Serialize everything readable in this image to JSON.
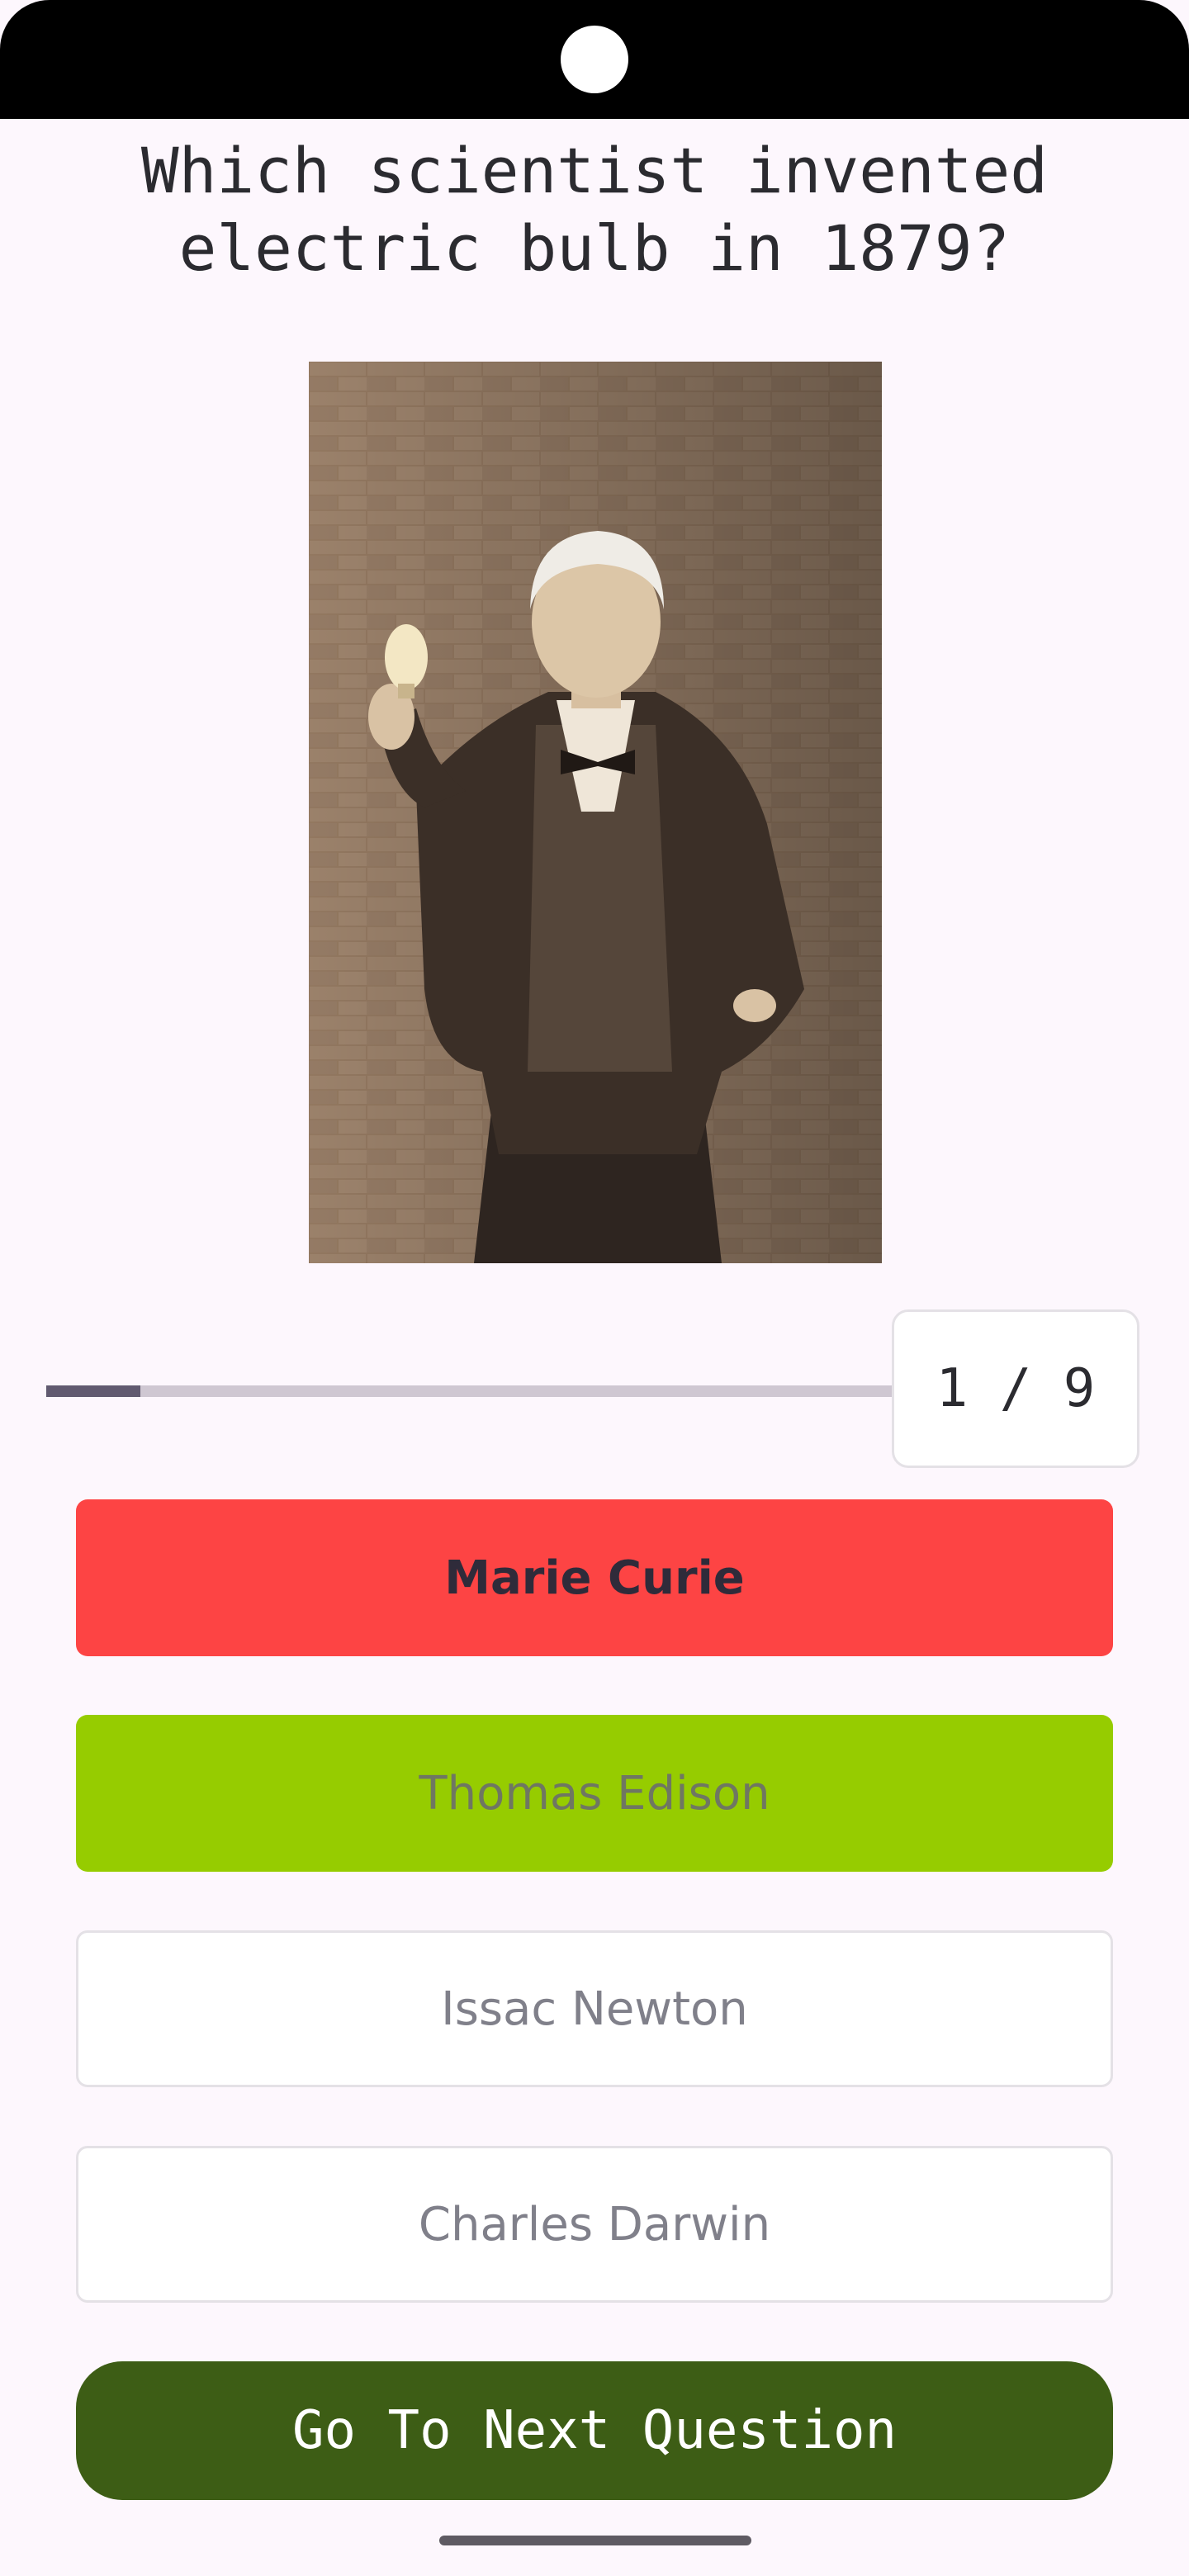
{
  "question": {
    "text": "Which scientist invented electric bulb in 1879?"
  },
  "image": {
    "subject": "portrait-photo",
    "tone": "#8a6f58"
  },
  "progress": {
    "current": 1,
    "total": 9,
    "label": "1 / 9",
    "fraction": 0.111
  },
  "options": [
    {
      "label": "Marie Curie",
      "state": "incorrect",
      "color": "#fd4444"
    },
    {
      "label": "Thomas Edison",
      "state": "correct",
      "color": "#96cc00"
    },
    {
      "label": "Issac Newton",
      "state": "default",
      "color": "#ffffff"
    },
    {
      "label": "Charles Darwin",
      "state": "default",
      "color": "#ffffff"
    }
  ],
  "next_button": {
    "label": "Go To Next Question",
    "color": "#3d5d15"
  }
}
